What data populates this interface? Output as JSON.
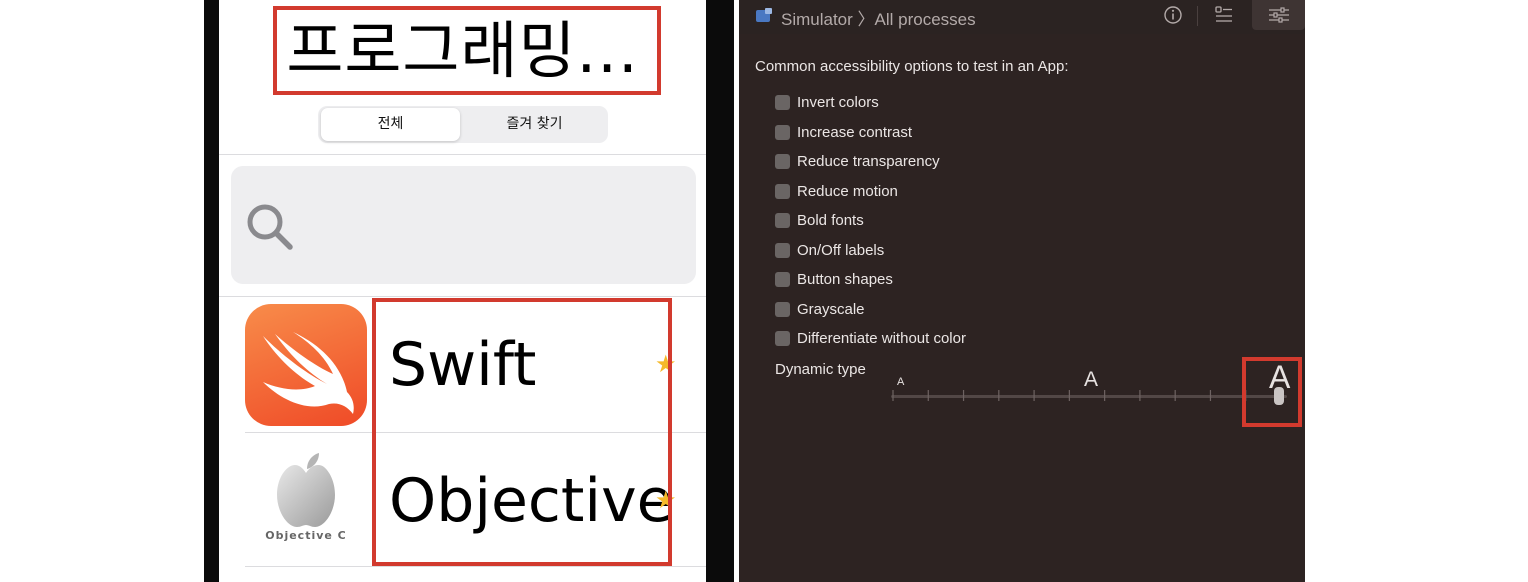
{
  "simulator": {
    "nav_title": "프로그래밍...",
    "segments": [
      "전체",
      "즐겨 찾기"
    ],
    "rows": [
      {
        "label": "Swift",
        "starred": true
      },
      {
        "label": "Objective",
        "starred": true
      }
    ],
    "objc_logo_caption": "Objective C",
    "star_glyph": "★",
    "colors": {
      "highlight": "#d23a2e",
      "star": "#f5b92a",
      "swift_orange": "#ef4a27"
    }
  },
  "inspector": {
    "breadcrumb": "Simulator 〉All processes",
    "section_title": "Common accessibility options to test in an App:",
    "options": [
      {
        "label": "Invert colors",
        "checked": false
      },
      {
        "label": "Increase contrast",
        "checked": false
      },
      {
        "label": "Reduce transparency",
        "checked": false
      },
      {
        "label": "Reduce motion",
        "checked": false
      },
      {
        "label": "Bold fonts",
        "checked": false
      },
      {
        "label": "On/Off labels",
        "checked": false
      },
      {
        "label": "Button shapes",
        "checked": false
      },
      {
        "label": "Grayscale",
        "checked": false
      },
      {
        "label": "Differentiate without color",
        "checked": false
      }
    ],
    "dynamic_type": {
      "label": "Dynamic type",
      "small_glyph": "A",
      "mid_glyph": "A",
      "large_glyph": "A",
      "value_fraction": 1.0,
      "tick_count": 12
    },
    "colors": {
      "background": "#2d2322",
      "text": "#ebe6e5",
      "checkbox": "#6a6564"
    }
  }
}
